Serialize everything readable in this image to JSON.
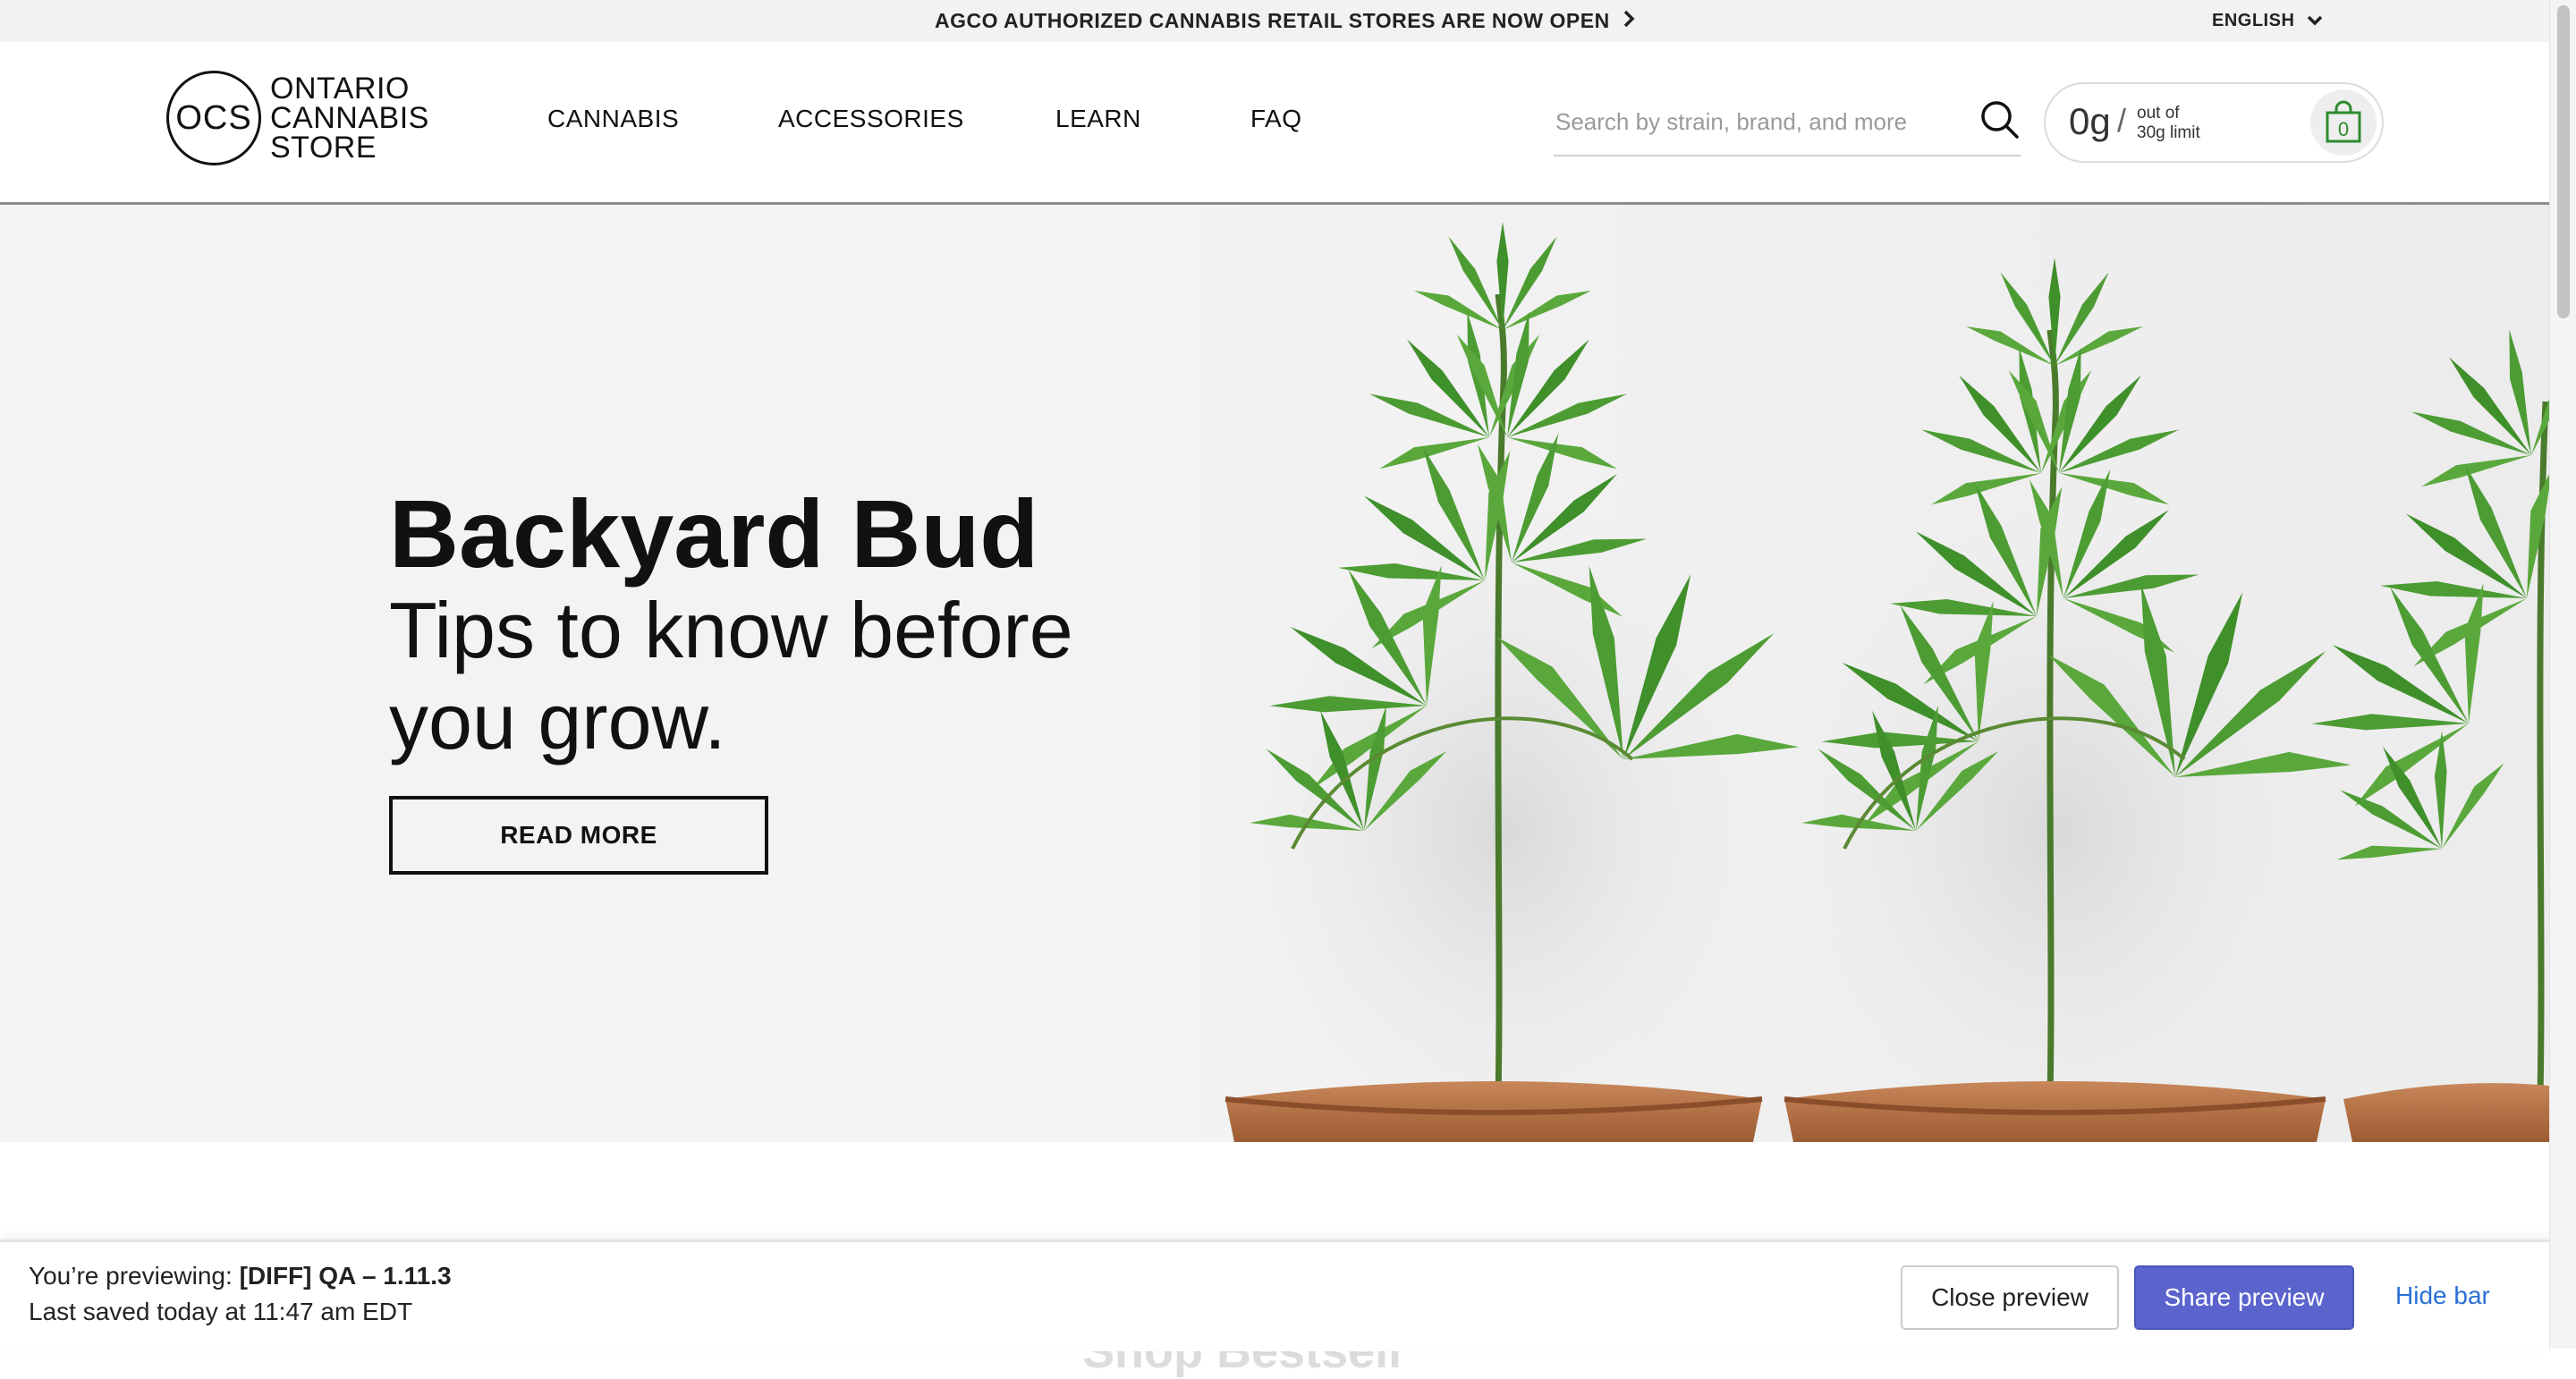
{
  "announcement": {
    "text": "AGCO AUTHORIZED CANNABIS RETAIL STORES ARE NOW OPEN",
    "chevron_icon": "chevron-right-icon"
  },
  "language": {
    "selected": "ENGLISH",
    "caret_icon": "chevron-down-icon"
  },
  "logo": {
    "monogram": "OCS",
    "line1": "ONTARIO",
    "line2": "CANNABIS",
    "line3": "STORE"
  },
  "nav": {
    "items": [
      {
        "label": "CANNABIS"
      },
      {
        "label": "ACCESSORIES"
      },
      {
        "label": "LEARN"
      },
      {
        "label": "FAQ"
      }
    ]
  },
  "search": {
    "placeholder": "Search by strain, brand, and more",
    "value": "",
    "icon": "search-icon"
  },
  "purchase_limit": {
    "amount": "0g",
    "slash": "/",
    "line1": "out of",
    "line2": "30g limit",
    "cart_count": "0",
    "icon": "shopping-bag-icon"
  },
  "hero": {
    "title": "Backyard Bud",
    "subtitle": "Tips to know before you grow.",
    "cta": "READ MORE"
  },
  "section": {
    "heading": "Shop Bestsell"
  },
  "preview_bar": {
    "previewing_prefix": "You’re previewing:",
    "previewing_name": "[DIFF] QA – 1.11.3",
    "last_saved": "Last saved today at 11:47 am EDT",
    "close_label": "Close preview",
    "share_label": "Share preview",
    "hide_label": "Hide bar"
  },
  "colors": {
    "accent_green": "#2e8b2e",
    "share_button": "#5b64cc",
    "link_blue": "#2a6fd6"
  }
}
